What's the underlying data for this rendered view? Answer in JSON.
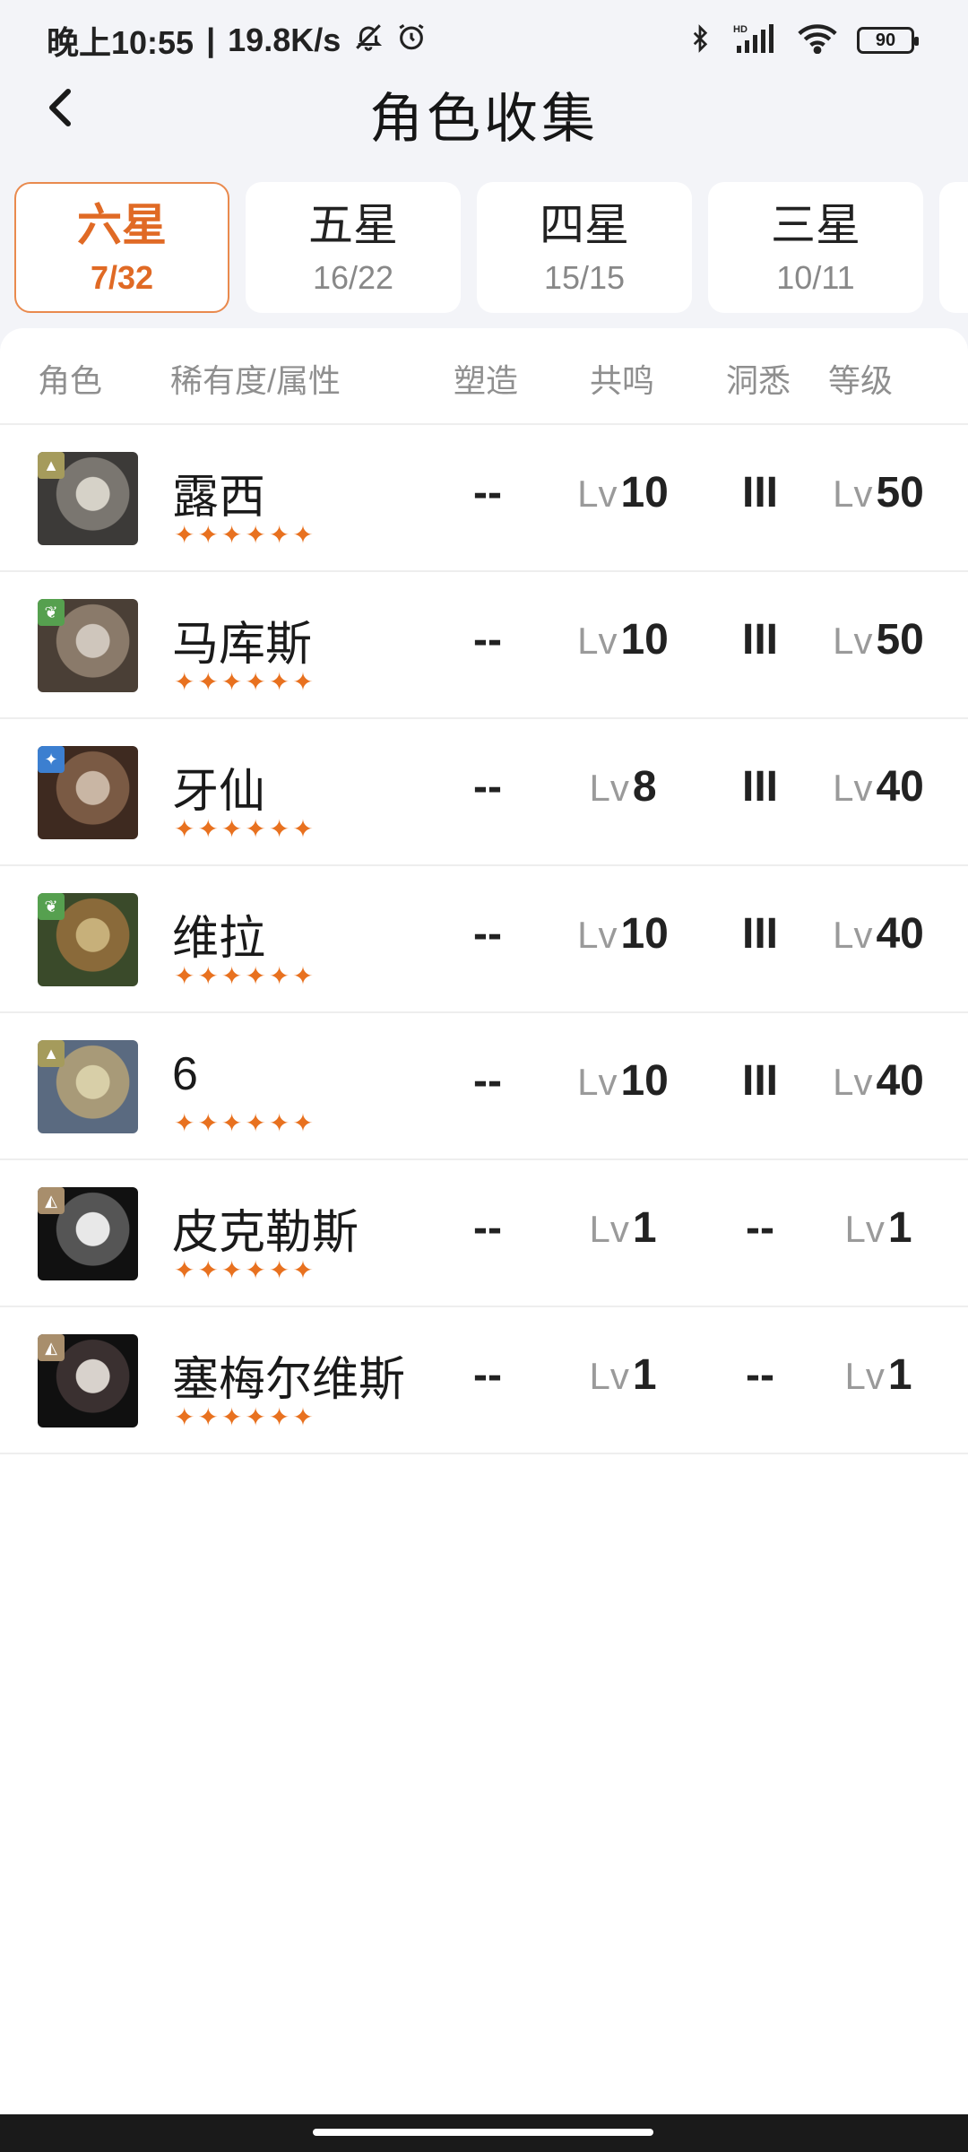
{
  "status_bar": {
    "time": "晚上10:55",
    "separator": "|",
    "speed": "19.8K/s",
    "battery": "90",
    "icons": [
      "muted-bell-icon",
      "alarm-icon",
      "bluetooth-icon",
      "hd-signal-icon",
      "wifi-icon",
      "battery-icon"
    ]
  },
  "header": {
    "title": "角色收集",
    "back_icon": "chevron-left-icon"
  },
  "tabs": [
    {
      "label": "六星",
      "count": "7/32",
      "active": true
    },
    {
      "label": "五星",
      "count": "16/22",
      "active": false
    },
    {
      "label": "四星",
      "count": "15/15",
      "active": false
    },
    {
      "label": "三星",
      "count": "10/11",
      "active": false
    }
  ],
  "table": {
    "headers": {
      "role": "角色",
      "rarity": "稀有度/属性",
      "shape": "塑造",
      "resonance": "共鸣",
      "insight": "洞悉",
      "level": "等级"
    },
    "lv_prefix": "Lv",
    "rows": [
      {
        "name": "露西",
        "stars": "✦✦✦✦✦✦",
        "element": "beast",
        "elem_color": "#a59b5c",
        "shape": "--",
        "resonance": "10",
        "insight": "III",
        "level": "50"
      },
      {
        "name": "马库斯",
        "stars": "✦✦✦✦✦✦",
        "element": "plant",
        "elem_color": "#56a04f",
        "shape": "--",
        "resonance": "10",
        "insight": "III",
        "level": "50"
      },
      {
        "name": "牙仙",
        "stars": "✦✦✦✦✦✦",
        "element": "star",
        "elem_color": "#3c7fd0",
        "shape": "--",
        "resonance": "8",
        "insight": "III",
        "level": "40"
      },
      {
        "name": "维拉",
        "stars": "✦✦✦✦✦✦",
        "element": "plant",
        "elem_color": "#56a04f",
        "shape": "--",
        "resonance": "10",
        "insight": "III",
        "level": "40"
      },
      {
        "name": "6",
        "stars": "✦✦✦✦✦✦",
        "element": "beast",
        "elem_color": "#a59b5c",
        "shape": "--",
        "resonance": "10",
        "insight": "III",
        "level": "40"
      },
      {
        "name": "皮克勒斯",
        "stars": "✦✦✦✦✦✦",
        "element": "intellect",
        "elem_color": "#a88e6c",
        "shape": "--",
        "resonance": "1",
        "insight": "--",
        "level": "1"
      },
      {
        "name": "塞梅尔维斯",
        "stars": "✦✦✦✦✦✦",
        "element": "intellect",
        "elem_color": "#a88e6c",
        "shape": "--",
        "resonance": "1",
        "insight": "--",
        "level": "1"
      }
    ]
  }
}
